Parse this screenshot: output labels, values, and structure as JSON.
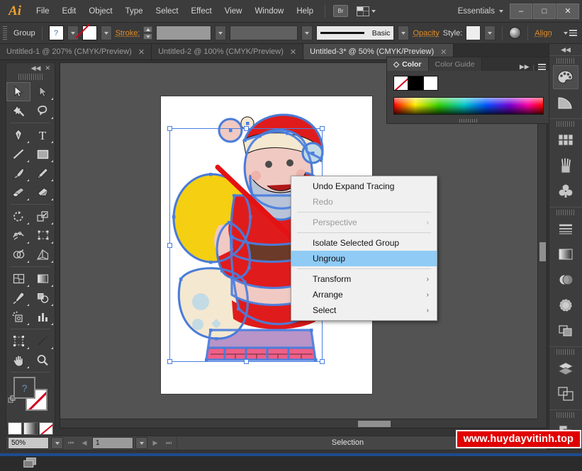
{
  "app": {
    "name": "Ai",
    "logo": "Ai"
  },
  "menubar": {
    "items": [
      "File",
      "Edit",
      "Object",
      "Type",
      "Select",
      "Effect",
      "View",
      "Window",
      "Help"
    ],
    "bridge_label": "Br",
    "workspace": "Essentials",
    "window_controls": {
      "minimize": "–",
      "maximize": "□",
      "close": "✕"
    }
  },
  "controlbar": {
    "selection_label": "Group",
    "fill_swatch": "?",
    "stroke_label": "Stroke:",
    "stroke_weight": "",
    "stroke_profile": "Basic",
    "opacity_label": "Opacity",
    "style_label": "Style:",
    "align_label": "Align"
  },
  "tabs": [
    {
      "title": "Untitled-1 @ 207% (CMYK/Preview)",
      "close": "✕",
      "active": false
    },
    {
      "title": "Untitled-2 @ 100% (CMYK/Preview)",
      "close": "✕",
      "active": false
    },
    {
      "title": "Untitled-3* @ 50% (CMYK/Preview)",
      "close": "✕",
      "active": true
    }
  ],
  "toolbar": {
    "collapse": "◀◀",
    "close": "✕",
    "tools": [
      "selection-tool",
      "direct-selection-tool",
      "magic-wand-tool",
      "lasso-tool",
      "pen-tool",
      "type-tool",
      "line-segment-tool",
      "rectangle-tool",
      "paintbrush-tool",
      "pencil-tool",
      "blob-brush-tool",
      "eraser-tool",
      "rotate-tool",
      "scale-tool",
      "width-tool",
      "free-transform-tool",
      "shape-builder-tool",
      "perspective-grid-tool",
      "mesh-tool",
      "gradient-tool",
      "eyedropper-tool",
      "blend-tool",
      "symbol-sprayer-tool",
      "column-graph-tool",
      "artboard-tool",
      "slice-tool",
      "hand-tool",
      "zoom-tool"
    ],
    "fill_value": "?",
    "stroke_value": "none"
  },
  "color_panel": {
    "tabs": [
      "Color",
      "Color Guide"
    ],
    "active_tab": "Color",
    "expand": "▶▶",
    "menu": "≡",
    "swatches": [
      "none",
      "#000000",
      "#ffffff"
    ]
  },
  "context_menu": {
    "items": [
      {
        "label": "Undo Expand Tracing",
        "disabled": false,
        "submenu": false,
        "highlight": false
      },
      {
        "label": "Redo",
        "disabled": true,
        "submenu": false,
        "highlight": false
      },
      {
        "separator": true
      },
      {
        "label": "Perspective",
        "disabled": true,
        "submenu": true,
        "highlight": false
      },
      {
        "separator": true
      },
      {
        "label": "Isolate Selected Group",
        "disabled": false,
        "submenu": false,
        "highlight": false
      },
      {
        "label": "Ungroup",
        "disabled": false,
        "submenu": false,
        "highlight": true
      },
      {
        "separator": true
      },
      {
        "label": "Transform",
        "disabled": false,
        "submenu": true,
        "highlight": false
      },
      {
        "label": "Arrange",
        "disabled": false,
        "submenu": true,
        "highlight": false
      },
      {
        "label": "Select",
        "disabled": false,
        "submenu": true,
        "highlight": false
      }
    ],
    "submenu_arrow": "›"
  },
  "statusbar": {
    "zoom": "50%",
    "page": "1",
    "status_text": "Selection",
    "first_page": "⏮",
    "prev_page": "◀",
    "next_page": "▶",
    "last_page": "⏭"
  },
  "dock": {
    "collapse": "◀◀",
    "items": [
      "color-panel-icon",
      "color-guide-icon",
      "swatches-panel-icon",
      "brushes-panel-icon",
      "symbols-panel-icon",
      "stroke-panel-icon",
      "gradient-panel-icon",
      "transparency-panel-icon",
      "appearance-panel-icon",
      "graphic-styles-panel-icon",
      "layers-panel-icon",
      "artboards-panel-icon",
      "links-panel-icon"
    ]
  },
  "artwork": {
    "name": "santa-claus-vector",
    "colors": {
      "sack": "#f5cf12",
      "suit_red": "#e01b1b",
      "suit_dark_red": "#b01818",
      "fur_white": "#f5e8d0",
      "skin": "#f0c9c2",
      "brown_belt": "#6b3a28",
      "chimney_purple": "#b894c8",
      "brick_pink": "#ef5f87",
      "pale_blue": "#c3dbe4",
      "anchor_blue": "#4a7fe0"
    }
  },
  "watermark": {
    "text": "www.huydayvitinh.top",
    "color": "#e00000"
  }
}
